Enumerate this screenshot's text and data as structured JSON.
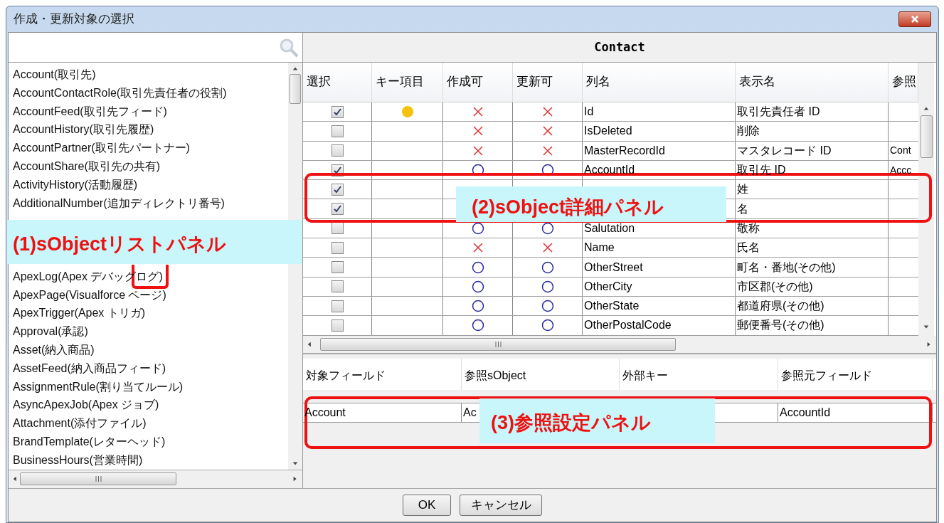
{
  "window": {
    "title": "作成・更新対象の選択"
  },
  "object_list": {
    "items": [
      {
        "text": "Account(取引先)"
      },
      {
        "text": "AccountContactRole(取引先責任者の役割)"
      },
      {
        "text": "AccountFeed(取引先フィード)"
      },
      {
        "text": "AccountHistory(取引先履歴)"
      },
      {
        "text": "AccountPartner(取引先パートナー)"
      },
      {
        "text": "AccountShare(取引先の共有)"
      },
      {
        "text": "ActivityHistory(活動履歴)"
      },
      {
        "text": "AdditionalNumber(追加ディレクトリ番号)",
        "covered_after": true
      },
      {
        "text": "ApexLog(Apex デバッグログ)"
      },
      {
        "text": "ApexPage(Visualforce ページ)"
      },
      {
        "text": "ApexTrigger(Apex トリガ)"
      },
      {
        "text": "Approval(承認)"
      },
      {
        "text": "Asset(納入商品)"
      },
      {
        "text": "AssetFeed(納入商品フィード)"
      },
      {
        "text": "AssignmentRule(割り当てルール)"
      },
      {
        "text": "AsyncApexJob(Apex ジョブ)"
      },
      {
        "text": "Attachment(添付ファイル)"
      },
      {
        "text": "BrandTemplate(レターヘッド)"
      },
      {
        "text": "BusinessHours(営業時間)"
      }
    ]
  },
  "detail": {
    "title": "Contact",
    "columns": [
      "選択",
      "キー項目",
      "作成可",
      "更新可",
      "列名",
      "表示名",
      "参照"
    ],
    "rows": [
      {
        "checked": true,
        "key": true,
        "creatable": false,
        "updatable": false,
        "column": "Id",
        "label": "取引先責任者 ID"
      },
      {
        "checked": false,
        "key": false,
        "creatable": false,
        "updatable": false,
        "column": "IsDeleted",
        "label": "削除"
      },
      {
        "checked": false,
        "key": false,
        "creatable": false,
        "updatable": false,
        "column": "MasterRecordId",
        "label": "マスタレコード ID",
        "reference": "Cont"
      },
      {
        "checked": true,
        "key": false,
        "creatable": true,
        "updatable": true,
        "column": "AccountId",
        "label": "取引先 ID",
        "reference": "Accc"
      },
      {
        "checked": true,
        "key": false,
        "label": "姓"
      },
      {
        "checked": true,
        "key": false,
        "label": "名"
      },
      {
        "checked": false,
        "key": false,
        "creatable": true,
        "updatable": true,
        "column": "Salutation",
        "label": "敬称"
      },
      {
        "checked": false,
        "key": false,
        "creatable": false,
        "updatable": false,
        "column": "Name",
        "label": "氏名"
      },
      {
        "checked": false,
        "key": false,
        "creatable": true,
        "updatable": true,
        "column": "OtherStreet",
        "label": "町名・番地(その他)"
      },
      {
        "checked": false,
        "key": false,
        "creatable": true,
        "updatable": true,
        "column": "OtherCity",
        "label": "市区郡(その他)"
      },
      {
        "checked": false,
        "key": false,
        "creatable": true,
        "updatable": true,
        "column": "OtherState",
        "label": "都道府県(その他)"
      },
      {
        "checked": false,
        "key": false,
        "creatable": true,
        "updatable": true,
        "column": "OtherPostalCode",
        "label": "郵便番号(その他)"
      }
    ]
  },
  "reference": {
    "columns": [
      "対象フィールド",
      "参照sObject",
      "外部キー",
      "参照元フィールド"
    ],
    "rows": [
      [
        "Account",
        "Ac",
        "",
        "AccountId"
      ]
    ]
  },
  "buttons": [
    "OK",
    "キャンセル"
  ],
  "annotations": [
    {
      "label": "(1)sObjectリストパネル"
    },
    {
      "label": "(2)sObject詳細パネル"
    },
    {
      "label": "(3)参照設定パネル"
    }
  ]
}
